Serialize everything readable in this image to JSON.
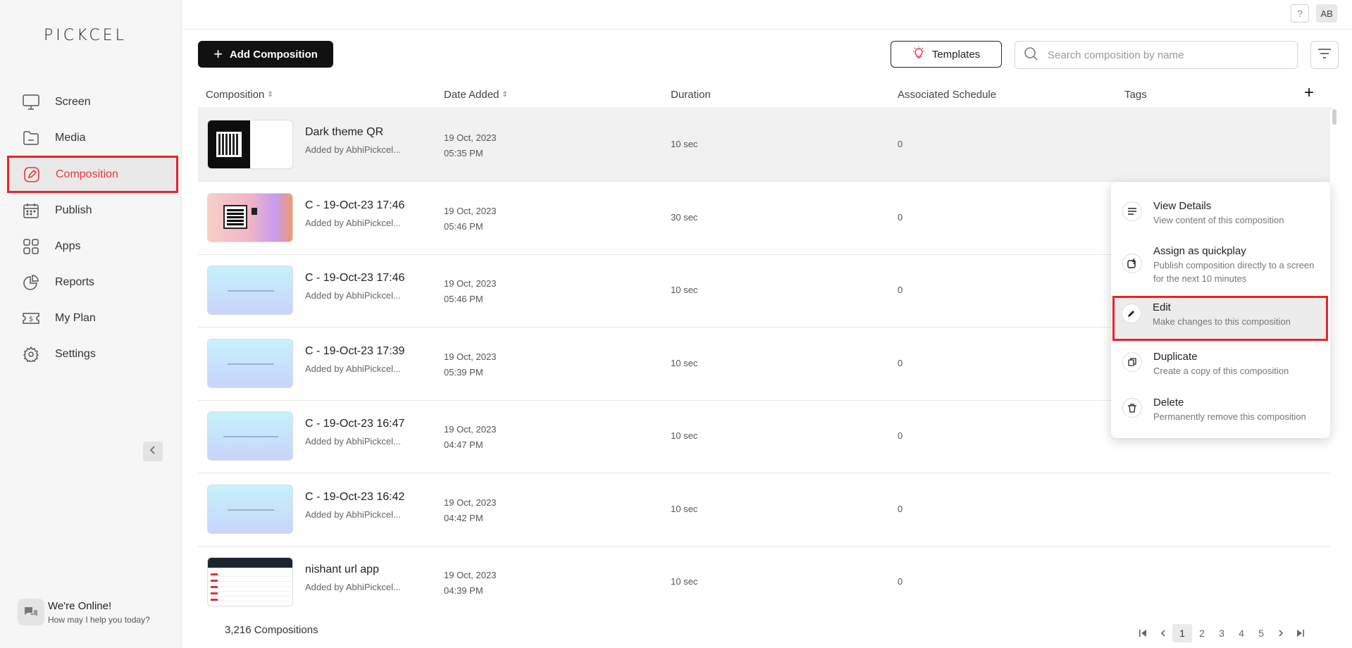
{
  "app": {
    "logo": "PICKCEL"
  },
  "sidebar": {
    "items": [
      {
        "label": "Screen",
        "icon": "monitor-icon"
      },
      {
        "label": "Media",
        "icon": "folder-icon"
      },
      {
        "label": "Composition",
        "icon": "edit-square-icon",
        "active": true
      },
      {
        "label": "Publish",
        "icon": "calendar-icon"
      },
      {
        "label": "Apps",
        "icon": "grid-icon"
      },
      {
        "label": "Reports",
        "icon": "pie-chart-icon"
      },
      {
        "label": "My Plan",
        "icon": "ticket-dollar-icon"
      },
      {
        "label": "Settings",
        "icon": "gear-icon"
      }
    ],
    "chat": {
      "title": "We're Online!",
      "subtitle": "How may I help you today?"
    }
  },
  "topbar": {
    "help": "?",
    "avatar": "AB"
  },
  "toolbar": {
    "add_label": "Add Composition",
    "templates_label": "Templates",
    "search_placeholder": "Search composition by name"
  },
  "table": {
    "headers": {
      "composition": "Composition",
      "date_added": "Date Added",
      "duration": "Duration",
      "schedule": "Associated Schedule",
      "tags": "Tags"
    },
    "rows": [
      {
        "name": "Dark theme QR",
        "added_by": "Added by AbhiPickcel...",
        "date": "19 Oct, 2023",
        "time": "05:35 PM",
        "duration": "10 sec",
        "schedule": "0"
      },
      {
        "name": "C - 19-Oct-23 17:46",
        "added_by": "Added by AbhiPickcel...",
        "date": "19 Oct, 2023",
        "time": "05:46 PM",
        "duration": "30 sec",
        "schedule": "0"
      },
      {
        "name": "C - 19-Oct-23 17:46",
        "added_by": "Added by AbhiPickcel...",
        "date": "19 Oct, 2023",
        "time": "05:46 PM",
        "duration": "10 sec",
        "schedule": "0"
      },
      {
        "name": "C - 19-Oct-23 17:39",
        "added_by": "Added by AbhiPickcel...",
        "date": "19 Oct, 2023",
        "time": "05:39 PM",
        "duration": "10 sec",
        "schedule": "0"
      },
      {
        "name": "C - 19-Oct-23 16:47",
        "added_by": "Added by AbhiPickcel...",
        "date": "19 Oct, 2023",
        "time": "04:47 PM",
        "duration": "10 sec",
        "schedule": "0"
      },
      {
        "name": "C - 19-Oct-23 16:42",
        "added_by": "Added by AbhiPickcel...",
        "date": "19 Oct, 2023",
        "time": "04:42 PM",
        "duration": "10 sec",
        "schedule": "0"
      },
      {
        "name": "nishant url app",
        "added_by": "Added by AbhiPickcel...",
        "date": "19 Oct, 2023",
        "time": "04:39 PM",
        "duration": "10 sec",
        "schedule": "0"
      }
    ]
  },
  "menu": {
    "items": [
      {
        "title": "View Details",
        "desc": "View content of this composition",
        "icon": "lines-icon"
      },
      {
        "title": "Assign as quickplay",
        "desc": "Publish composition directly to a screen for the next 10 minutes",
        "icon": "quickplay-icon"
      },
      {
        "title": "Edit",
        "desc": "Make changes to this composition",
        "icon": "pencil-icon"
      },
      {
        "title": "Duplicate",
        "desc": "Create a copy of this composition",
        "icon": "copy-icon"
      },
      {
        "title": "Delete",
        "desc": "Permanently remove this composition",
        "icon": "trash-icon"
      }
    ]
  },
  "footer": {
    "count": "3,216 Compositions",
    "pages": [
      "1",
      "2",
      "3",
      "4",
      "5"
    ],
    "current_page": "1"
  },
  "colors": {
    "accent": "#e8373c",
    "highlight_border": "#e8242b",
    "primary_button": "#111111"
  }
}
